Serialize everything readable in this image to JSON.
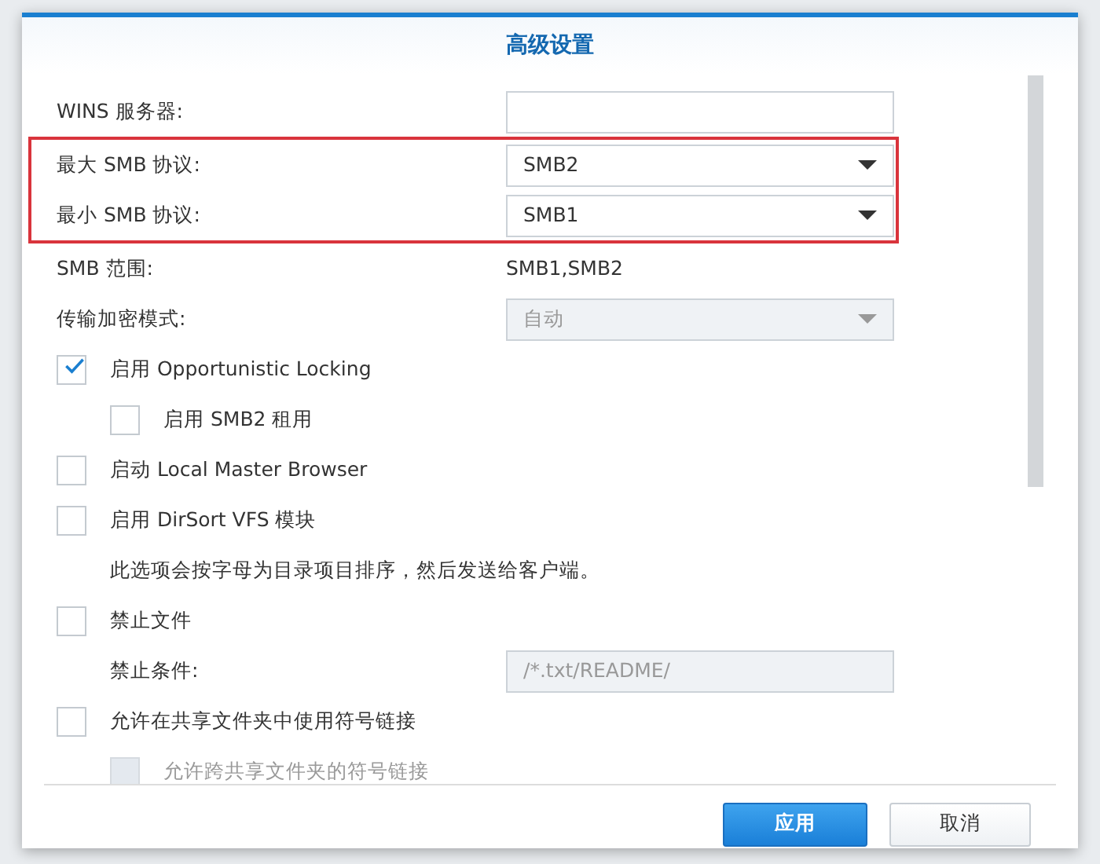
{
  "dialog": {
    "title": "高级设置"
  },
  "rows": [
    {
      "kind": "input",
      "label": "WINS 服务器:",
      "disabled": false
    },
    {
      "kind": "highlight-group",
      "children": [
        {
          "kind": "select",
          "label": "最大 SMB 协议:",
          "value": "SMB2",
          "disabled": false
        },
        {
          "kind": "select",
          "label": "最小 SMB 协议:",
          "value": "SMB1",
          "disabled": false
        }
      ]
    },
    {
      "kind": "static",
      "label": "SMB 范围:",
      "value": "SMB1,SMB2"
    },
    {
      "kind": "select",
      "label": "传输加密模式:",
      "value": "自动",
      "disabled": true
    },
    {
      "kind": "checkbox",
      "label": "启用 Opportunistic Locking",
      "checked": true,
      "disabled": false,
      "children": [
        {
          "kind": "checkbox",
          "label": "启用 SMB2 租用",
          "checked": false,
          "disabled": false
        }
      ]
    },
    {
      "kind": "checkbox",
      "label": "启动 Local Master Browser",
      "checked": false,
      "disabled": false
    },
    {
      "kind": "checkbox",
      "label": "启用 DirSort VFS 模块",
      "checked": false,
      "disabled": false,
      "children": [
        {
          "kind": "note",
          "label": "此选项会按字母为目录项目排序，然后发送给客户端。"
        }
      ]
    },
    {
      "kind": "checkbox",
      "label": "禁止文件",
      "checked": false,
      "disabled": false,
      "children": [
        {
          "kind": "input",
          "label": "禁止条件:",
          "value": "/*.txt/README/",
          "disabled": true
        }
      ]
    },
    {
      "kind": "checkbox",
      "label": "允许在共享文件夹中使用符号链接",
      "checked": false,
      "disabled": false,
      "children": [
        {
          "kind": "checkbox",
          "label": "允许跨共享文件夹的符号链接",
          "checked": false,
          "disabled": true
        }
      ]
    }
  ],
  "buttons": [
    {
      "label": "应用",
      "kind": "primary"
    },
    {
      "label": "取消",
      "kind": "secondary"
    }
  ]
}
